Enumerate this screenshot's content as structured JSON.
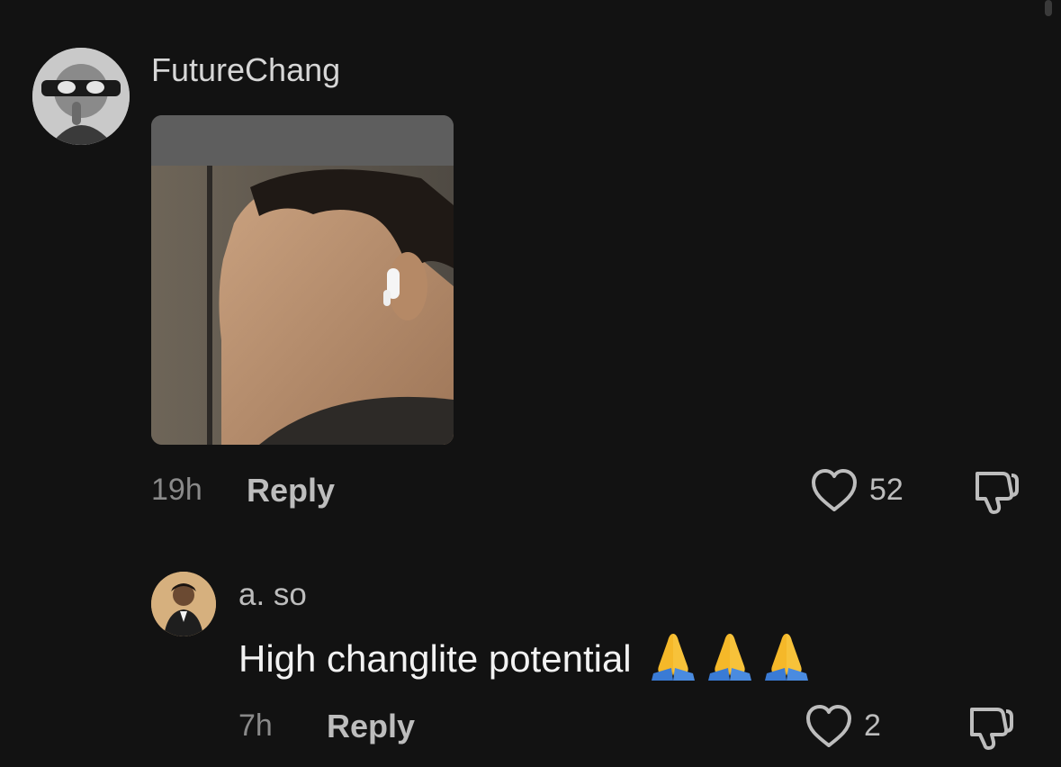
{
  "comments": [
    {
      "username": "FutureChang",
      "time": "19h",
      "reply_label": "Reply",
      "likes": "52",
      "avatar_icon": "avatar-masked-figure-icon",
      "attachment": "photo-thumbnail"
    },
    {
      "username": "a. so",
      "text": "High changlite potential",
      "emoji": [
        "pray-emoji",
        "pray-emoji",
        "pray-emoji"
      ],
      "time": "7h",
      "reply_label": "Reply",
      "likes": "2",
      "avatar_icon": "avatar-child-in-suit-icon"
    }
  ],
  "colors": {
    "background": "#121212",
    "text_primary": "#f2f2f2",
    "text_secondary": "#bdbdbd",
    "text_muted": "#8a8a8a"
  }
}
